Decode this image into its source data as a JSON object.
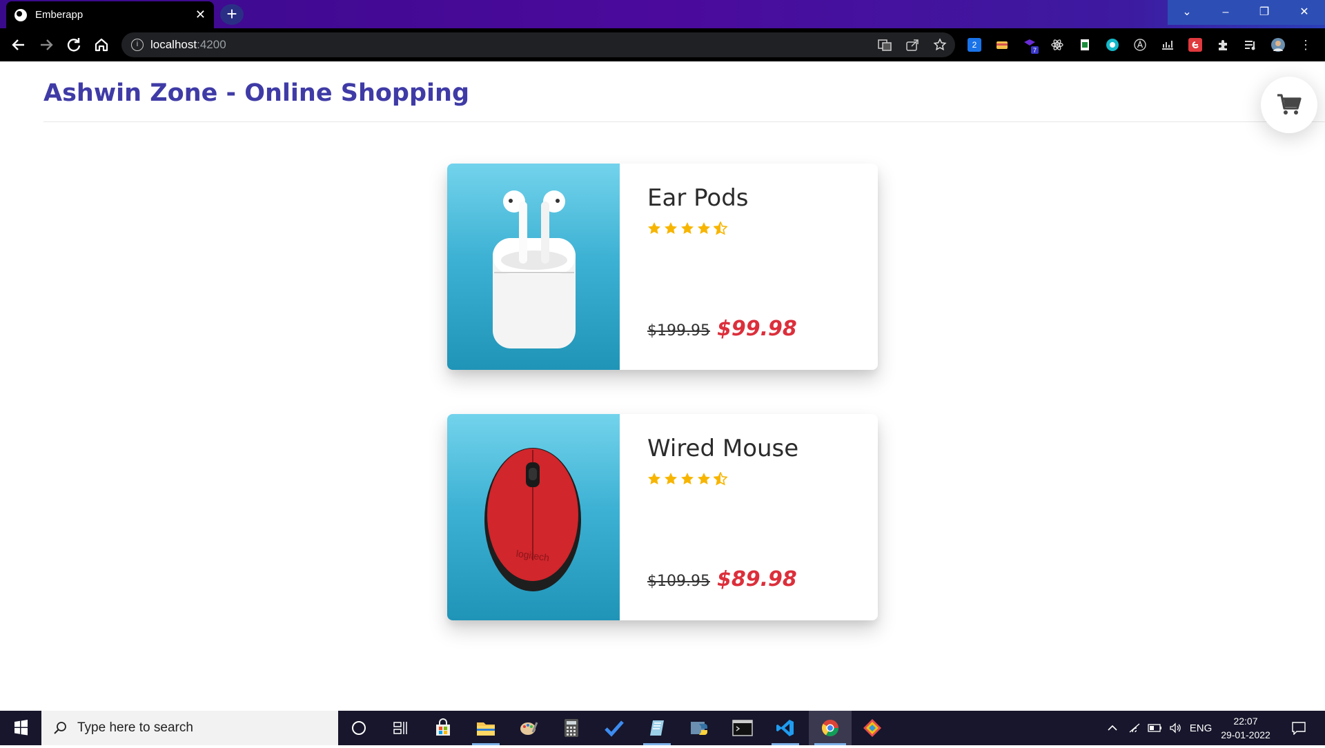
{
  "browser": {
    "tab_title": "Emberapp",
    "tab_close": "✕",
    "new_tab": "+",
    "url_host": "localhost",
    "url_port": ":4200",
    "window_controls": {
      "tabs_list": "⌄",
      "minimize": "–",
      "restore": "❐",
      "close": "✕"
    },
    "extension_badge_2": "2",
    "extension_badge_7": "7"
  },
  "site": {
    "title": "Ashwin Zone - Online Shopping"
  },
  "products": [
    {
      "name": "Ear Pods",
      "rating": 4.5,
      "original_price": "$199.95",
      "sale_price": "$99.98",
      "image_alt": "earpods-image"
    },
    {
      "name": "Wired Mouse",
      "rating": 4.5,
      "original_price": "$109.95",
      "sale_price": "$89.98",
      "image_alt": "mouse-image"
    }
  ],
  "colors": {
    "title": "#3f3ba6",
    "sale_price": "#dc2f3b",
    "star": "#f7b500",
    "card_image_top": "#73d3ec",
    "card_image_bottom": "#1f94b7"
  },
  "taskbar": {
    "search_placeholder": "Type here to search",
    "language": "ENG",
    "time": "22:07",
    "date": "29-01-2022"
  }
}
